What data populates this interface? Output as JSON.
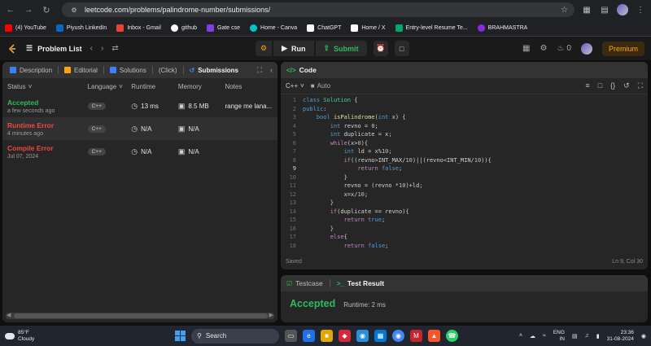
{
  "browser": {
    "url": "leetcode.com/problems/palindrome-number/submissions/",
    "bookmarks": [
      {
        "label": "(4) YouTube",
        "color": "#ff0000"
      },
      {
        "label": "Piyush LinkedIn",
        "color": "#0a66c2"
      },
      {
        "label": "Inbox - Gmail",
        "color": "#ea4335"
      },
      {
        "label": "github",
        "color": "#ffffff"
      },
      {
        "label": "Gate cse",
        "color": "#7b3fe4"
      },
      {
        "label": "Home - Canva",
        "color": "#00c4cc"
      },
      {
        "label": "ChatGPT",
        "color": "#ffffff"
      },
      {
        "label": "Home / X",
        "color": "#ffffff"
      },
      {
        "label": "Entry-level Resume Te...",
        "color": "#00a86b"
      },
      {
        "label": "BRAHMASTRA",
        "color": "#8a2be2"
      }
    ]
  },
  "header": {
    "problem_list": "Problem List",
    "run": "Run",
    "submit": "Submit",
    "fire_count": "0",
    "premium": "Premium"
  },
  "left_tabs": {
    "description": "Description",
    "editorial": "Editorial",
    "solutions": "Solutions",
    "click": "(Click)",
    "submissions": "Submissions"
  },
  "table": {
    "headers": [
      "Status",
      "Language",
      "Runtime",
      "Memory",
      "Notes"
    ],
    "rows": [
      {
        "status": "Accepted",
        "time": "a few seconds ago",
        "lang": "C++",
        "runtime": "13 ms",
        "memory": "8.5 MB",
        "notes": "range me lana..."
      },
      {
        "status": "Runtime Error",
        "time": "4 minutes ago",
        "lang": "C++",
        "runtime": "N/A",
        "memory": "N/A",
        "notes": ""
      },
      {
        "status": "Compile Error",
        "time": "Jul 07, 2024",
        "lang": "C++",
        "runtime": "N/A",
        "memory": "N/A",
        "notes": ""
      }
    ]
  },
  "code": {
    "title": "Code",
    "language": "C++",
    "auto": "Auto",
    "status": "Saved",
    "cursor": "Ln 9, Col 30",
    "line_numbers": [
      "1",
      "2",
      "3",
      "4",
      "5",
      "6",
      "7",
      "8",
      "9",
      "10",
      "11",
      "12",
      "13",
      "14",
      "15",
      "16",
      "17",
      "18"
    ]
  },
  "test": {
    "testcase": "Testcase",
    "result_tab": "Test Result",
    "verdict": "Accepted",
    "runtime": "Runtime: 2 ms"
  },
  "taskbar": {
    "temp": "85°F",
    "weather": "Cloudy",
    "search": "Search",
    "lang1": "ENG",
    "lang2": "IN",
    "time": "23:36",
    "date": "31-08-2024"
  }
}
